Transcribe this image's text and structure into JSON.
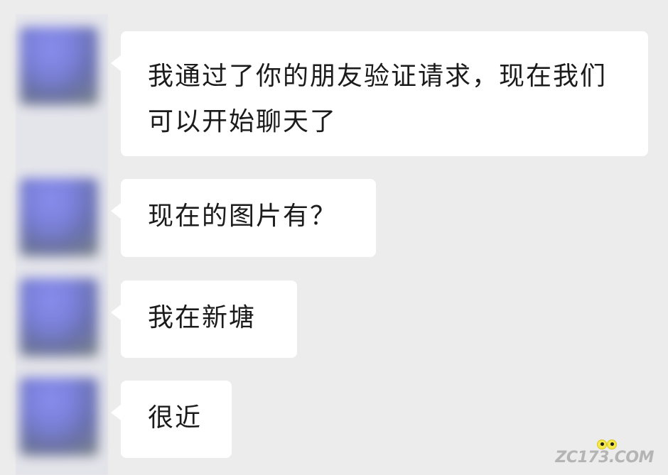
{
  "messages": [
    {
      "text": "我通过了你的朋友验证请求，现在我们可以开始聊天了"
    },
    {
      "text": "现在的图片有？"
    },
    {
      "text": "我在新塘"
    },
    {
      "text": "很近"
    }
  ],
  "watermark": {
    "text": "ZC173.COM"
  }
}
